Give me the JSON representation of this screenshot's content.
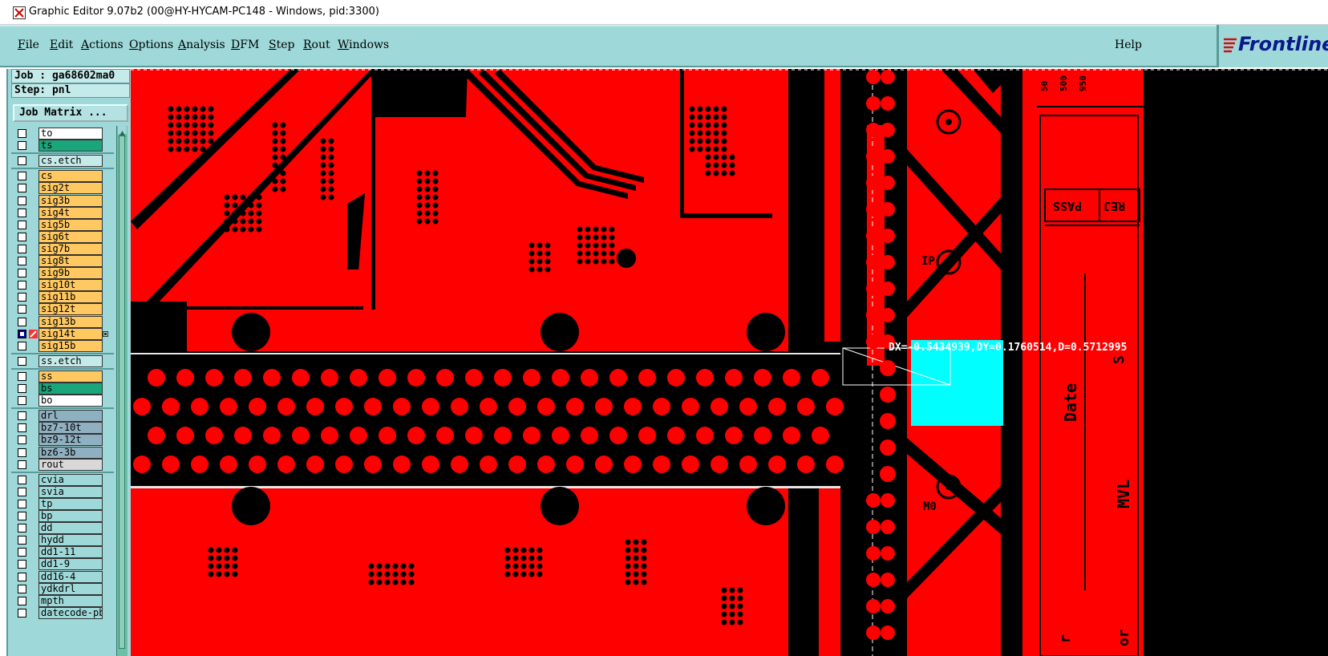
{
  "window": {
    "title": "Graphic Editor 9.07b2 (00@HY-HYCAM-PC148 - Windows, pid:3300)"
  },
  "menu": {
    "items": [
      "File",
      "Edit",
      "Actions",
      "Options",
      "Analysis",
      "DFM",
      "Step",
      "Rout",
      "Windows"
    ],
    "help": "Help"
  },
  "logo": {
    "text": "Frontline"
  },
  "panel": {
    "job": "Job : ga68602ma0",
    "step": "Step: pnl",
    "job_matrix": "Job Matrix ..."
  },
  "layers": [
    {
      "name": "to",
      "color": "#ffffff",
      "checked": false
    },
    {
      "name": "ts",
      "color": "#1aa57a",
      "checked": false
    },
    {
      "name": "cs.etch",
      "color": "#c5eaea",
      "checked": false
    },
    {
      "name": "cs",
      "color": "#ffc860",
      "checked": false
    },
    {
      "name": "sig2t",
      "color": "#ffc860",
      "checked": false
    },
    {
      "name": "sig3b",
      "color": "#ffc860",
      "checked": false
    },
    {
      "name": "sig4t",
      "color": "#ffc860",
      "checked": false
    },
    {
      "name": "sig5b",
      "color": "#ffc860",
      "checked": false
    },
    {
      "name": "sig6t",
      "color": "#ffc860",
      "checked": false
    },
    {
      "name": "sig7b",
      "color": "#ffc860",
      "checked": false
    },
    {
      "name": "sig8t",
      "color": "#ffc860",
      "checked": false
    },
    {
      "name": "sig9b",
      "color": "#ffc860",
      "checked": false
    },
    {
      "name": "sig10t",
      "color": "#ffc860",
      "checked": false
    },
    {
      "name": "sig11b",
      "color": "#ffc860",
      "checked": false
    },
    {
      "name": "sig12t",
      "color": "#ffc860",
      "checked": false
    },
    {
      "name": "sig13b",
      "color": "#ffc860",
      "checked": false
    },
    {
      "name": "sig14t",
      "color": "#ffc860",
      "checked": true
    },
    {
      "name": "sig15b",
      "color": "#ffc860",
      "checked": false
    },
    {
      "name": "ss.etch",
      "color": "#c5eaea",
      "checked": false
    },
    {
      "name": "ss",
      "color": "#ffc860",
      "checked": false
    },
    {
      "name": "bs",
      "color": "#1aa57a",
      "checked": false
    },
    {
      "name": "bo",
      "color": "#ffffff",
      "checked": false
    },
    {
      "name": "drl",
      "color": "#8fb0c0",
      "checked": false
    },
    {
      "name": "bz7-10t",
      "color": "#8fb0c0",
      "checked": false
    },
    {
      "name": "bz9-12t",
      "color": "#8fb0c0",
      "checked": false
    },
    {
      "name": "bz6-3b",
      "color": "#8fb0c0",
      "checked": false
    },
    {
      "name": "rout",
      "color": "#d8d8d8",
      "checked": false
    },
    {
      "name": "cvia",
      "color": "#9ed8d8",
      "checked": false
    },
    {
      "name": "svia",
      "color": "#9ed8d8",
      "checked": false
    },
    {
      "name": "tp",
      "color": "#9ed8d8",
      "checked": false
    },
    {
      "name": "bp",
      "color": "#9ed8d8",
      "checked": false
    },
    {
      "name": "dd",
      "color": "#9ed8d8",
      "checked": false
    },
    {
      "name": "hydd",
      "color": "#9ed8d8",
      "checked": false
    },
    {
      "name": "dd1-11",
      "color": "#9ed8d8",
      "checked": false
    },
    {
      "name": "dd1-9",
      "color": "#9ed8d8",
      "checked": false
    },
    {
      "name": "dd16-4",
      "color": "#9ed8d8",
      "checked": false
    },
    {
      "name": "ydkdrl",
      "color": "#9ed8d8",
      "checked": false
    },
    {
      "name": "mpth",
      "color": "#9ed8d8",
      "checked": false
    },
    {
      "name": "datecode-pbc",
      "color": "#9ed8d8",
      "checked": false
    }
  ],
  "canvas": {
    "measurement": "DX=-0.5434939,DY=0.1760514,D=0.5712995",
    "texts": {
      "pass": "PASS",
      "rej": "REJ",
      "date": "Date",
      "s": "S",
      "mvl": "MVL",
      "ip": "IP",
      "m0": "M0",
      "v50": "50",
      "v500": "500",
      "v950": "950",
      "r": "r",
      "or": "or"
    }
  },
  "colors": {
    "copper": "#ff0000",
    "background": "#000000",
    "highlight": "#00ffff",
    "panel": "#9ed8d8"
  }
}
